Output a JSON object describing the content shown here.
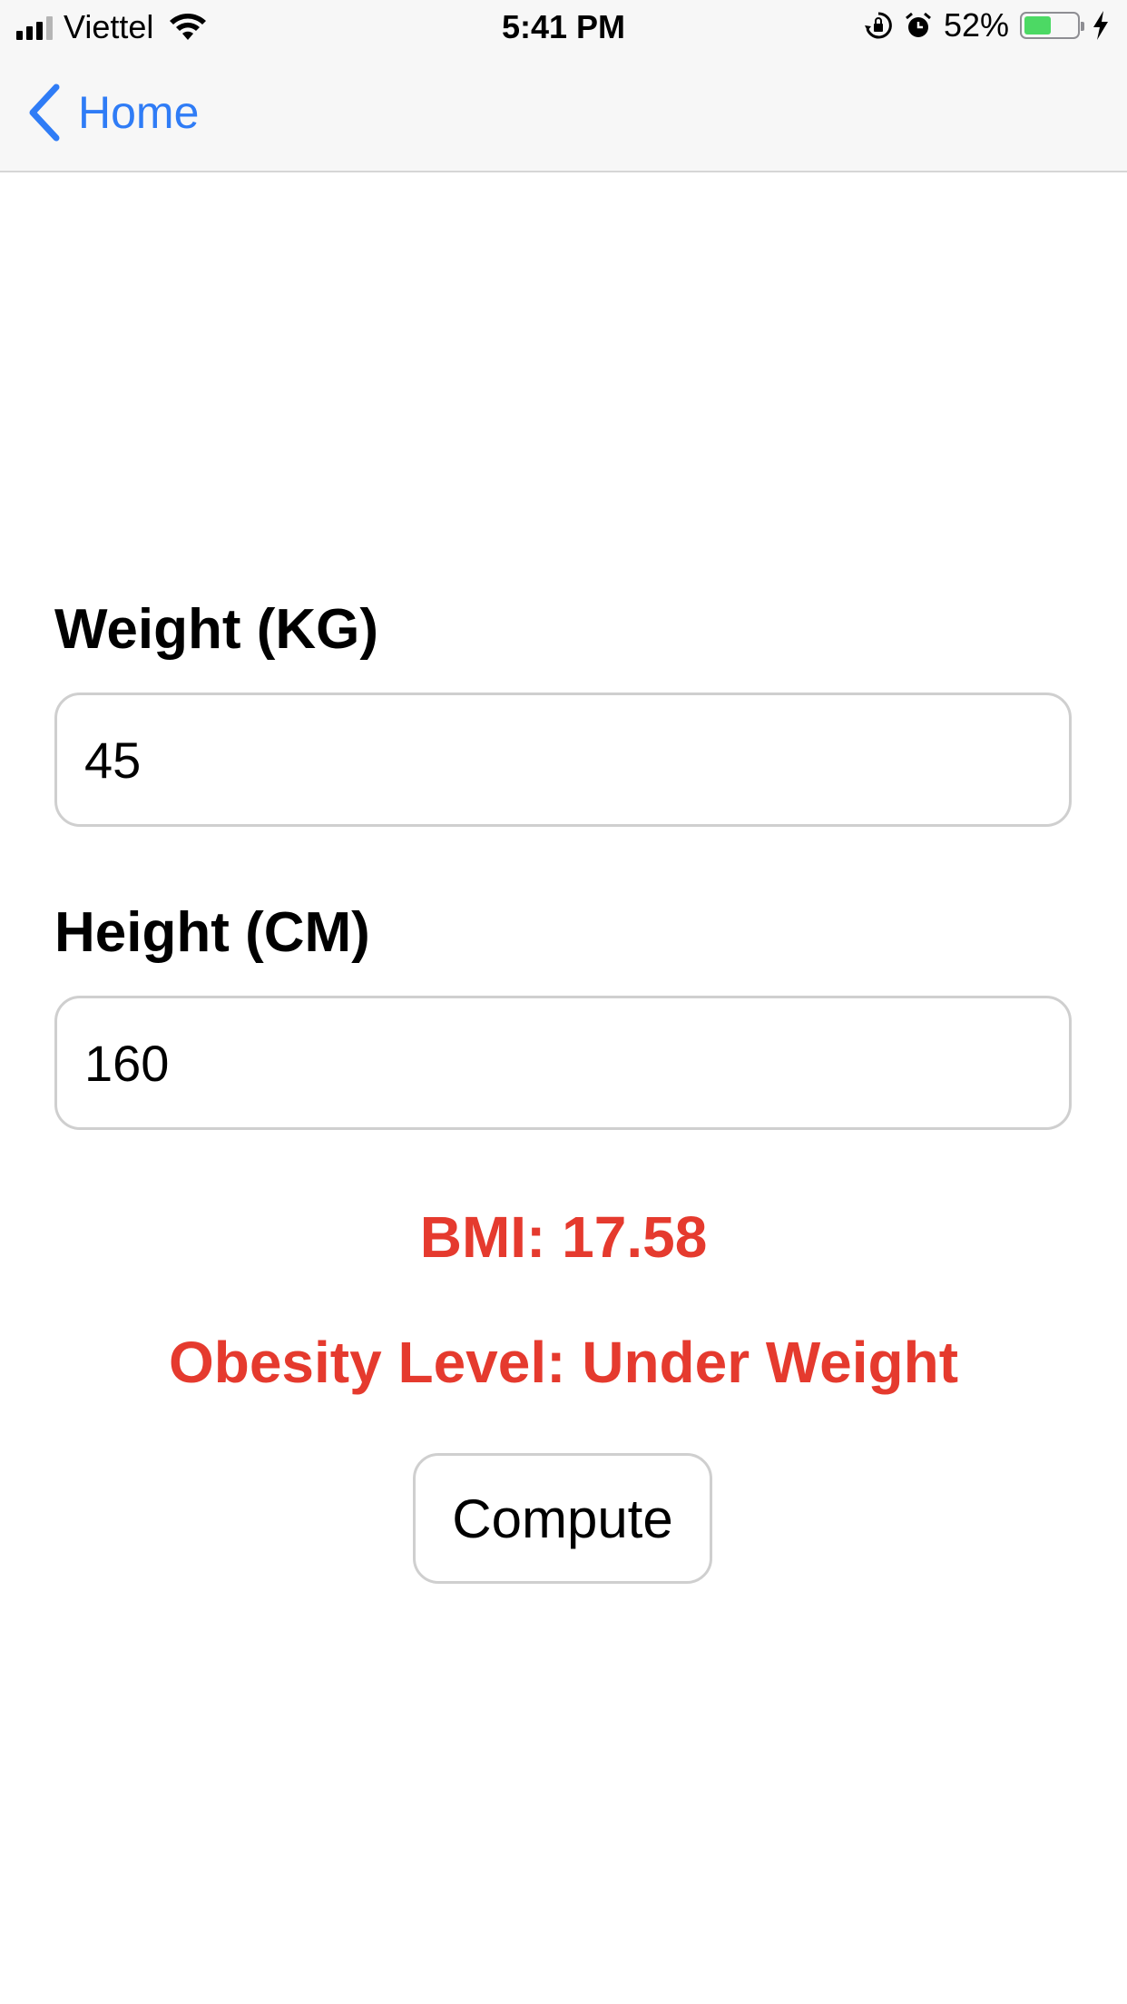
{
  "status_bar": {
    "carrier": "Viettel",
    "time": "5:41 PM",
    "battery_percent": "52%",
    "battery_level": 0.52,
    "icons": [
      "signal-icon",
      "wifi-icon",
      "orientation-lock-icon",
      "alarm-icon",
      "battery-icon",
      "charging-icon"
    ]
  },
  "nav": {
    "back_label": "Home"
  },
  "form": {
    "weight_label": "Weight (KG)",
    "weight_value": "45",
    "height_label": "Height (CM)",
    "height_value": "160",
    "bmi_text": "BMI: 17.58",
    "obesity_text": "Obesity Level: Under Weight",
    "compute_label": "Compute"
  },
  "colors": {
    "accent": "#2f7cf6",
    "result": "#e53a2e",
    "battery": "#4cd964"
  }
}
